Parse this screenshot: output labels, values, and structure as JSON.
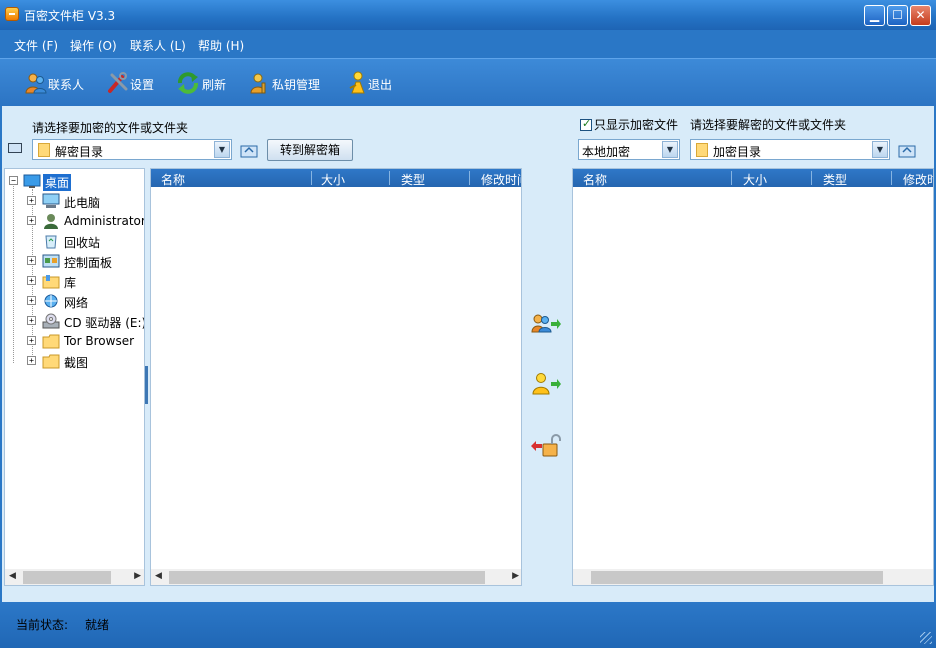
{
  "window": {
    "title": "百密文件柜 V3.3"
  },
  "menu": [
    {
      "label": "文件 (F)"
    },
    {
      "label": "操作 (O)"
    },
    {
      "label": "联系人 (L)"
    },
    {
      "label": "帮助 (H)"
    }
  ],
  "toolbar": [
    {
      "label": "联系人",
      "icon": "contacts-icon"
    },
    {
      "label": "设置",
      "icon": "settings-tools-icon"
    },
    {
      "label": "刷新",
      "icon": "refresh-icon"
    },
    {
      "label": "私钥管理",
      "icon": "private-key-icon"
    },
    {
      "label": "退出",
      "icon": "exit-icon"
    }
  ],
  "left": {
    "caption": "请选择要加密的文件或文件夹",
    "path_combo": "解密目录",
    "goto_button": "转到解密箱",
    "tree": [
      {
        "label": "桌面",
        "icon": "desktop-icon",
        "root": true
      },
      {
        "label": "此电脑",
        "icon": "computer-icon"
      },
      {
        "label": "Administrator",
        "icon": "user-icon"
      },
      {
        "label": "回收站",
        "icon": "recycle-bin-icon"
      },
      {
        "label": "控制面板",
        "icon": "control-panel-icon"
      },
      {
        "label": "库",
        "icon": "library-icon"
      },
      {
        "label": "网络",
        "icon": "network-icon"
      },
      {
        "label": "CD 驱动器 (E:)",
        "icon": "cd-drive-icon"
      },
      {
        "label": "Tor Browser",
        "icon": "folder-icon"
      },
      {
        "label": "截图",
        "icon": "folder-icon"
      }
    ],
    "columns": [
      "名称",
      "大小",
      "类型",
      "修改时间"
    ]
  },
  "right": {
    "checkbox_label": "只显示加密文件",
    "checkbox_checked": true,
    "caption": "请选择要解密的文件或文件夹",
    "mode_combo": "本地加密",
    "path_combo": "加密目录",
    "columns": [
      "名称",
      "大小",
      "类型",
      "修改时间"
    ]
  },
  "middle_actions": [
    {
      "icon": "encrypt-for-contacts-icon"
    },
    {
      "icon": "encrypt-for-self-icon"
    },
    {
      "icon": "decrypt-icon"
    }
  ],
  "status": {
    "label": "当前状态:",
    "value": "就绪"
  },
  "colors": {
    "accent": "#2a77c6",
    "panel": "#d8ebf9",
    "header": "#2f78c8"
  }
}
